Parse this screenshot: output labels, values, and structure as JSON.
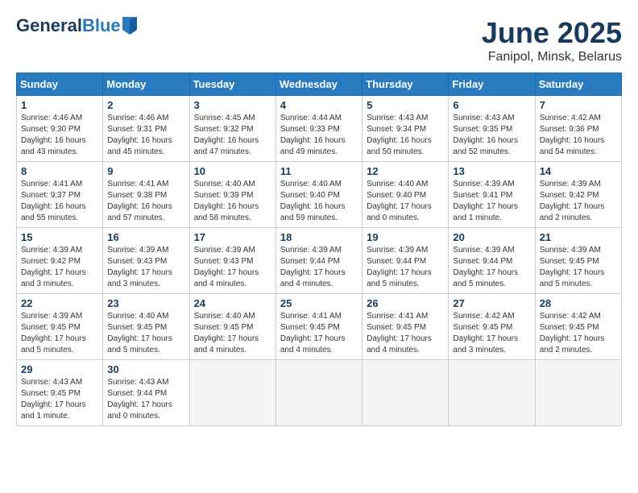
{
  "header": {
    "logo_line1": "General",
    "logo_line2": "Blue",
    "title": "June 2025",
    "subtitle": "Fanipol, Minsk, Belarus"
  },
  "weekdays": [
    "Sunday",
    "Monday",
    "Tuesday",
    "Wednesday",
    "Thursday",
    "Friday",
    "Saturday"
  ],
  "weeks": [
    [
      {
        "day": "1",
        "info": "Sunrise: 4:46 AM\nSunset: 9:30 PM\nDaylight: 16 hours\nand 43 minutes."
      },
      {
        "day": "2",
        "info": "Sunrise: 4:46 AM\nSunset: 9:31 PM\nDaylight: 16 hours\nand 45 minutes."
      },
      {
        "day": "3",
        "info": "Sunrise: 4:45 AM\nSunset: 9:32 PM\nDaylight: 16 hours\nand 47 minutes."
      },
      {
        "day": "4",
        "info": "Sunrise: 4:44 AM\nSunset: 9:33 PM\nDaylight: 16 hours\nand 49 minutes."
      },
      {
        "day": "5",
        "info": "Sunrise: 4:43 AM\nSunset: 9:34 PM\nDaylight: 16 hours\nand 50 minutes."
      },
      {
        "day": "6",
        "info": "Sunrise: 4:43 AM\nSunset: 9:35 PM\nDaylight: 16 hours\nand 52 minutes."
      },
      {
        "day": "7",
        "info": "Sunrise: 4:42 AM\nSunset: 9:36 PM\nDaylight: 16 hours\nand 54 minutes."
      }
    ],
    [
      {
        "day": "8",
        "info": "Sunrise: 4:41 AM\nSunset: 9:37 PM\nDaylight: 16 hours\nand 55 minutes."
      },
      {
        "day": "9",
        "info": "Sunrise: 4:41 AM\nSunset: 9:38 PM\nDaylight: 16 hours\nand 57 minutes."
      },
      {
        "day": "10",
        "info": "Sunrise: 4:40 AM\nSunset: 9:39 PM\nDaylight: 16 hours\nand 58 minutes."
      },
      {
        "day": "11",
        "info": "Sunrise: 4:40 AM\nSunset: 9:40 PM\nDaylight: 16 hours\nand 59 minutes."
      },
      {
        "day": "12",
        "info": "Sunrise: 4:40 AM\nSunset: 9:40 PM\nDaylight: 17 hours\nand 0 minutes."
      },
      {
        "day": "13",
        "info": "Sunrise: 4:39 AM\nSunset: 9:41 PM\nDaylight: 17 hours\nand 1 minute."
      },
      {
        "day": "14",
        "info": "Sunrise: 4:39 AM\nSunset: 9:42 PM\nDaylight: 17 hours\nand 2 minutes."
      }
    ],
    [
      {
        "day": "15",
        "info": "Sunrise: 4:39 AM\nSunset: 9:42 PM\nDaylight: 17 hours\nand 3 minutes."
      },
      {
        "day": "16",
        "info": "Sunrise: 4:39 AM\nSunset: 9:43 PM\nDaylight: 17 hours\nand 3 minutes."
      },
      {
        "day": "17",
        "info": "Sunrise: 4:39 AM\nSunset: 9:43 PM\nDaylight: 17 hours\nand 4 minutes."
      },
      {
        "day": "18",
        "info": "Sunrise: 4:39 AM\nSunset: 9:44 PM\nDaylight: 17 hours\nand 4 minutes."
      },
      {
        "day": "19",
        "info": "Sunrise: 4:39 AM\nSunset: 9:44 PM\nDaylight: 17 hours\nand 5 minutes."
      },
      {
        "day": "20",
        "info": "Sunrise: 4:39 AM\nSunset: 9:44 PM\nDaylight: 17 hours\nand 5 minutes."
      },
      {
        "day": "21",
        "info": "Sunrise: 4:39 AM\nSunset: 9:45 PM\nDaylight: 17 hours\nand 5 minutes."
      }
    ],
    [
      {
        "day": "22",
        "info": "Sunrise: 4:39 AM\nSunset: 9:45 PM\nDaylight: 17 hours\nand 5 minutes."
      },
      {
        "day": "23",
        "info": "Sunrise: 4:40 AM\nSunset: 9:45 PM\nDaylight: 17 hours\nand 5 minutes."
      },
      {
        "day": "24",
        "info": "Sunrise: 4:40 AM\nSunset: 9:45 PM\nDaylight: 17 hours\nand 4 minutes."
      },
      {
        "day": "25",
        "info": "Sunrise: 4:41 AM\nSunset: 9:45 PM\nDaylight: 17 hours\nand 4 minutes."
      },
      {
        "day": "26",
        "info": "Sunrise: 4:41 AM\nSunset: 9:45 PM\nDaylight: 17 hours\nand 4 minutes."
      },
      {
        "day": "27",
        "info": "Sunrise: 4:42 AM\nSunset: 9:45 PM\nDaylight: 17 hours\nand 3 minutes."
      },
      {
        "day": "28",
        "info": "Sunrise: 4:42 AM\nSunset: 9:45 PM\nDaylight: 17 hours\nand 2 minutes."
      }
    ],
    [
      {
        "day": "29",
        "info": "Sunrise: 4:43 AM\nSunset: 9:45 PM\nDaylight: 17 hours\nand 1 minute."
      },
      {
        "day": "30",
        "info": "Sunrise: 4:43 AM\nSunset: 9:44 PM\nDaylight: 17 hours\nand 0 minutes."
      },
      {
        "day": "",
        "info": ""
      },
      {
        "day": "",
        "info": ""
      },
      {
        "day": "",
        "info": ""
      },
      {
        "day": "",
        "info": ""
      },
      {
        "day": "",
        "info": ""
      }
    ]
  ]
}
